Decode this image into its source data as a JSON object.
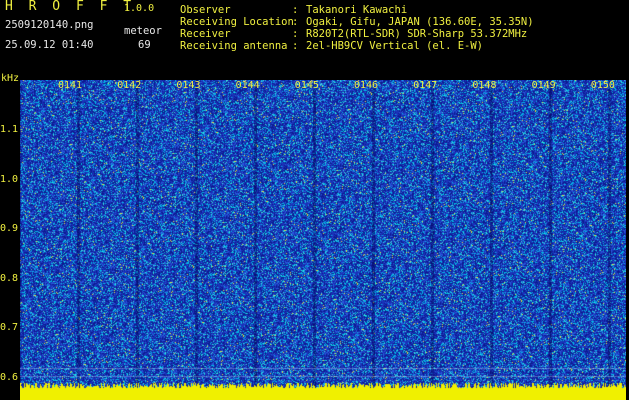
{
  "header": {
    "app_title": "H R O F F T",
    "app_version": "1.0.0",
    "file_name": "2509120140.png",
    "type_label": "meteor",
    "date_time": "25.09.12 01:40",
    "count": "69"
  },
  "info": [
    {
      "label": "Observer",
      "value": "Takanori Kawachi"
    },
    {
      "label": "Receiving Location",
      "value": "Ogaki, Gifu, JAPAN (136.60E, 35.35N)"
    },
    {
      "label": "Receiver",
      "value": "R820T2(RTL-SDR) SDR-Sharp 53.372MHz"
    },
    {
      "label": "Receiving antenna",
      "value": "2el-HB9CV Vertical (el. E-W)"
    }
  ],
  "separator": ":",
  "spectrogram": {
    "freq_unit": "kHz",
    "time_labels": [
      "0141",
      "0142",
      "0143",
      "0144",
      "0145",
      "0146",
      "0147",
      "0148",
      "0149",
      "0150"
    ],
    "freq_labels": [
      "1.1",
      "1.0",
      "0.9",
      "0.8",
      "0.7",
      "0.6"
    ],
    "colors": {
      "background": "#1a2fb0",
      "noise_dark": "#0c1a90",
      "noise_light": "#00c8e8",
      "noise_yellow": "#e8e840",
      "baseline": "#f0f000",
      "axis_text": "#f0f040"
    }
  }
}
